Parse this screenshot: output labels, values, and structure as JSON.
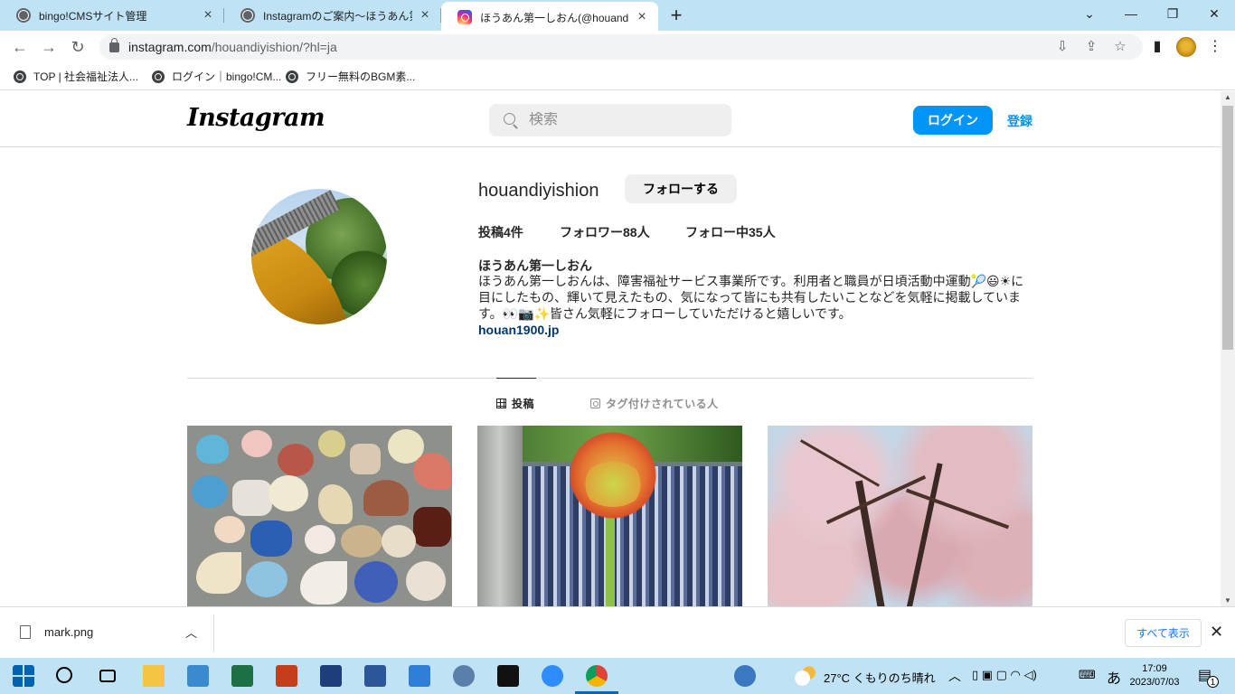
{
  "browser": {
    "tabs": [
      {
        "title": "bingo!CMSサイト管理",
        "icon": "globe-icon"
      },
      {
        "title": "Instagramのご案内〜ほうあん第一しおん",
        "icon": "globe-icon"
      },
      {
        "title": "ほうあん第一しおん(@houandiyishion)",
        "icon": "instagram-icon",
        "active": true
      }
    ],
    "url_host": "instagram.com",
    "url_path": "/houandiyishion/?hl=ja",
    "bookmarks": [
      "TOP | 社会福祉法人...",
      "ログイン｜bingo!CM...",
      "フリー無料のBGM素..."
    ]
  },
  "instagram": {
    "logo": "Instagram",
    "search_placeholder": "検索",
    "login_label": "ログイン",
    "signup_label": "登録",
    "profile": {
      "username": "houandiyishion",
      "follow_label": "フォローする",
      "posts": "投稿4件",
      "followers": "フォロワー88人",
      "following": "フォロー中35人",
      "name": "ほうあん第一しおん",
      "bio": "ほうあん第一しおんは、障害福祉サービス事業所です。利用者と職員が日頃活動中運動🎾😃☀に目にしたもの、輝いて見えたもの、気になって皆にも共有したいことなどを気軽に掲載しています。👀📷✨皆さん気軽にフォローしていただけると嬉しいです。",
      "link": "houan1900.jp"
    },
    "tabs": {
      "posts": "投稿",
      "tagged": "タグ付けされている人"
    },
    "colors": {
      "primary": "#0095f6",
      "link": "#00376b"
    }
  },
  "download": {
    "file": "mark.png",
    "show_all": "すべて表示"
  },
  "taskbar": {
    "weather": "27°C くもりのち晴れ",
    "time": "17:09",
    "date": "2023/07/03",
    "ime": "あ",
    "notif_count": "1"
  }
}
